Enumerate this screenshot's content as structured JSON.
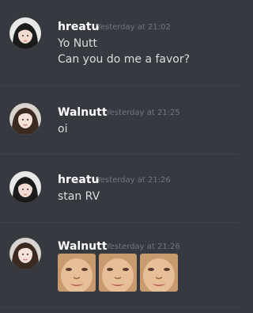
{
  "messages": [
    {
      "author": "hreatu",
      "timestamp": "Yesterday at 21:02",
      "lines": [
        "Yo Nutt",
        "Can you do me a favor?"
      ],
      "avatar": "avatar-hreatu"
    },
    {
      "author": "Walnutt",
      "timestamp": "Yesterday at 21:25",
      "lines": [
        "oi"
      ],
      "avatar": "avatar-walnutt"
    },
    {
      "author": "hreatu",
      "timestamp": "Yesterday at 21:26",
      "lines": [
        "stan RV"
      ],
      "avatar": "avatar-hreatu"
    },
    {
      "author": "Walnutt",
      "timestamp": "Yesterday at 21:26",
      "attachments": [
        "face-emoji",
        "face-emoji",
        "face-emoji"
      ],
      "avatar": "avatar-walnutt"
    }
  ],
  "colors": {
    "background": "#36393f",
    "author": "#ffffff",
    "timestamp": "#72767d",
    "message_text": "#dcddde",
    "divider": "#3f4248"
  }
}
